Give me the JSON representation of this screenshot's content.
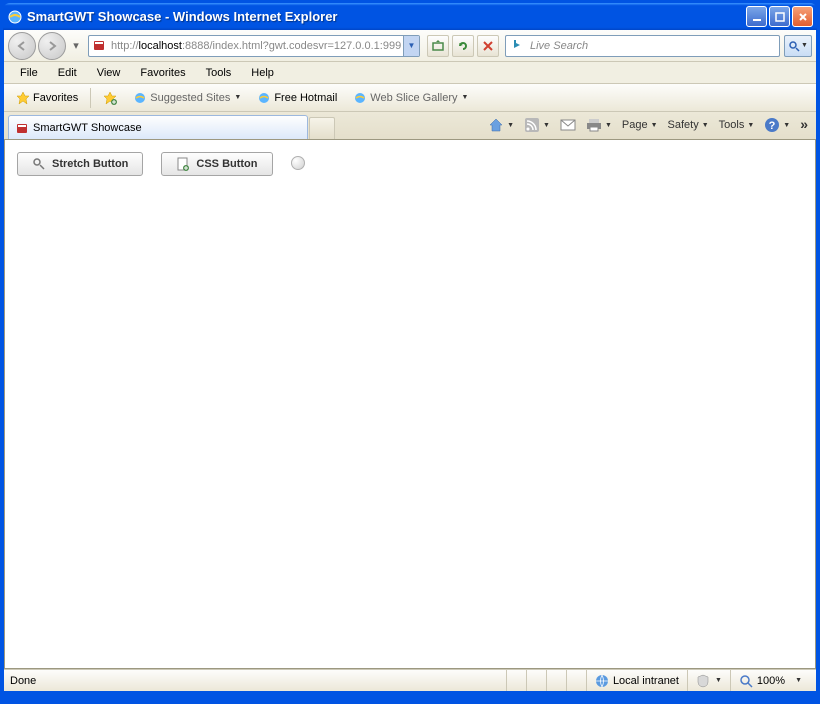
{
  "window": {
    "title": "SmartGWT Showcase - Windows Internet Explorer"
  },
  "address": {
    "scheme": "http://",
    "host": "localhost",
    "rest": ":8888/index.html?gwt.codesvr=127.0.0.1:999"
  },
  "search": {
    "placeholder": "Live Search"
  },
  "menu": {
    "file": "File",
    "edit": "Edit",
    "view": "View",
    "favorites": "Favorites",
    "tools": "Tools",
    "help": "Help"
  },
  "favbar": {
    "favorites": "Favorites",
    "suggested": "Suggested Sites",
    "hotmail": "Free Hotmail",
    "webslice": "Web Slice Gallery"
  },
  "tab": {
    "label": "SmartGWT Showcase"
  },
  "cmd": {
    "page": "Page",
    "safety": "Safety",
    "tools": "Tools"
  },
  "content": {
    "stretch_button": "Stretch Button",
    "css_button": "CSS Button"
  },
  "status": {
    "done": "Done",
    "zone": "Local intranet",
    "zoom": "100%"
  }
}
